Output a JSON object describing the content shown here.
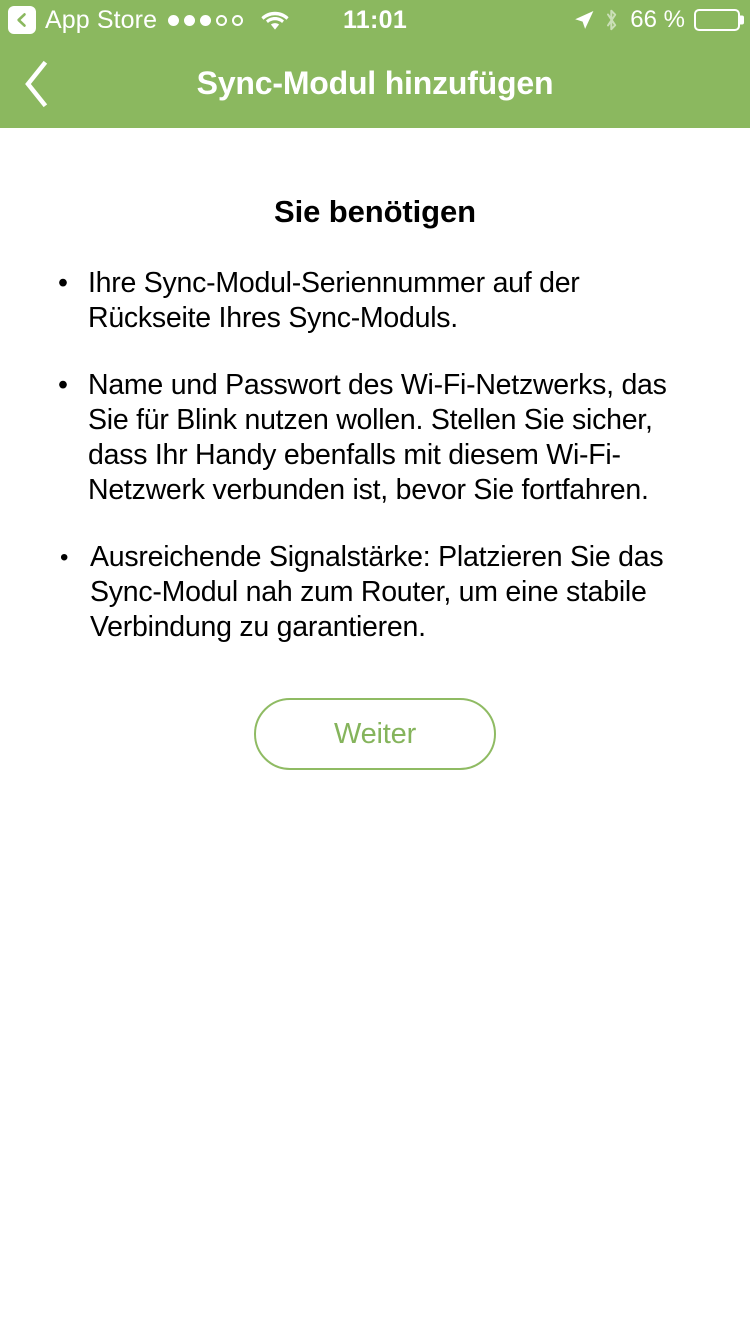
{
  "status_bar": {
    "back_icon": "back-chevron-icon",
    "carrier_label": "App Store",
    "signal_dots_filled": 3,
    "signal_dots_total": 5,
    "wifi_icon": "wifi-icon",
    "time": "11:01",
    "location_icon": "location-arrow-icon",
    "bluetooth_icon": "bluetooth-icon",
    "battery_percent_label": "66 %",
    "battery_level": 66
  },
  "nav_bar": {
    "back_icon": "chevron-left-icon",
    "title": "Sync-Modul hinzufügen",
    "background_color": "#8BB85F"
  },
  "main": {
    "heading": "Sie benötigen",
    "bullets": [
      {
        "marker": "•",
        "text": "Ihre Sync-Modul-Seriennummer auf der Rückseite Ihres Sync-Moduls."
      },
      {
        "marker": "•",
        "text": "Name und Passwort des Wi-Fi-Netzwerks, das Sie für Blink nutzen wollen. Stellen Sie sicher, dass Ihr Handy ebenfalls mit diesem Wi-Fi-Netzwerk verbunden ist, bevor Sie fortfahren."
      },
      {
        "marker": "•",
        "text": "Ausreichende Signalstärke: Platzieren Sie das Sync-Modul nah zum Router, um eine stabile Verbindung zu garantieren."
      }
    ],
    "primary_button_label": "Weiter",
    "accent_color": "#8BB85F"
  }
}
